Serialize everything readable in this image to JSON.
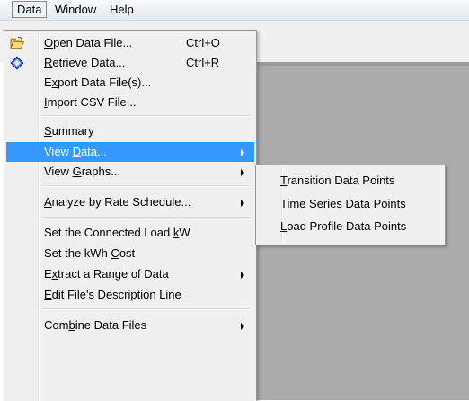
{
  "menubar": {
    "items": [
      {
        "label": "Data",
        "open": true
      },
      {
        "label": "Window"
      },
      {
        "label": "Help"
      }
    ]
  },
  "data_menu": {
    "items": [
      {
        "label": "Open Data File...",
        "shortcut": "Ctrl+O",
        "icon": "folder-open-icon",
        "mnemonic": "O"
      },
      {
        "label": "Retrieve Data...",
        "shortcut": "Ctrl+R",
        "icon": "retrieve-diamond-icon",
        "mnemonic": "R"
      },
      {
        "label": "Export Data File(s)...",
        "mnemonic": "x"
      },
      {
        "label": "Import CSV File...",
        "mnemonic": "I"
      },
      {
        "label": "Summary",
        "mnemonic": "S"
      },
      {
        "label": "View Data...",
        "highlighted": true,
        "submenu": true,
        "mnemonic": "D"
      },
      {
        "label": "View Graphs...",
        "submenu": true,
        "mnemonic": "G"
      },
      {
        "label": "Analyze by Rate Schedule...",
        "submenu": true,
        "mnemonic": "A"
      },
      {
        "label": "Set the Connected Load kW",
        "mnemonic": "k"
      },
      {
        "label": "Set the kWh Cost",
        "mnemonic": "C"
      },
      {
        "label": "Extract a Range of Data",
        "submenu": true,
        "mnemonic": "x"
      },
      {
        "label": "Edit File's Description Line",
        "mnemonic": "E"
      },
      {
        "label": "Combine Data Files",
        "submenu": true,
        "mnemonic": "b"
      }
    ]
  },
  "view_data_submenu": {
    "items": [
      {
        "label": "Transition Data Points",
        "mnemonic": "T"
      },
      {
        "label": "Time Series Data Points",
        "mnemonic": "S"
      },
      {
        "label": "Load Profile Data Points",
        "mnemonic": "L"
      }
    ]
  },
  "colors": {
    "highlight": "#3399ff",
    "menu_bg": "#f0f0f0",
    "client_bg": "#ababab"
  }
}
